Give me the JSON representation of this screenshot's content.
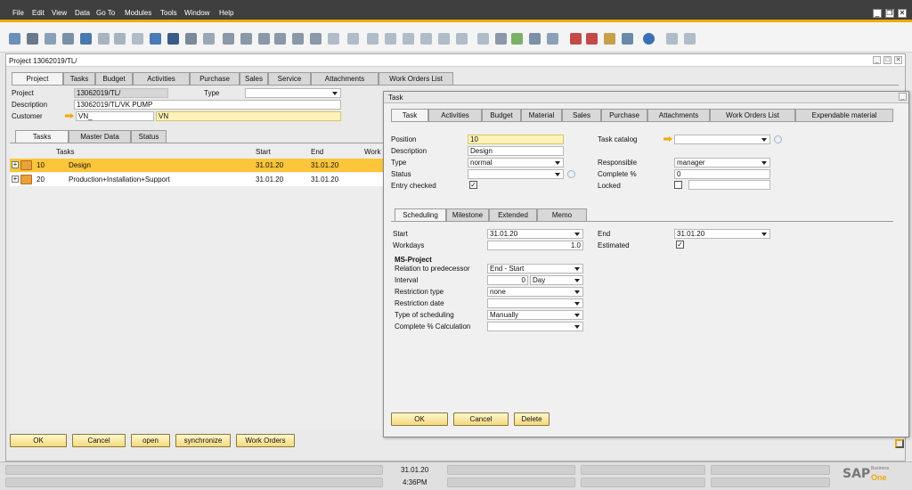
{
  "menu": [
    "File",
    "Edit",
    "View",
    "Data",
    "Go To",
    "Modules",
    "Tools",
    "Window",
    "Help"
  ],
  "project_window": {
    "title": "Project 13062019/TL/",
    "tabs": [
      "Project",
      "Tasks",
      "Budget",
      "Activities",
      "Purchase",
      "Sales",
      "Service",
      "Attachments",
      "Work Orders List"
    ],
    "fields": {
      "project_label": "Project",
      "project_value": "13062019/TL/",
      "type_label": "Type",
      "type_value": "",
      "description_label": "Description",
      "description_value": "13062019/TL/VK PUMP",
      "customer_label": "Customer",
      "customer_code": "VN_",
      "customer_name": "VN"
    },
    "sub_tabs": [
      "Tasks",
      "Master Data",
      "Status"
    ],
    "grid_headers": [
      "Tasks",
      "Start",
      "End",
      "Work"
    ],
    "rows": [
      {
        "num": "10",
        "name": "Design",
        "start": "31.01.20",
        "end": "31.01.20"
      },
      {
        "num": "20",
        "name": "Production+Installation+Support",
        "start": "31.01.20",
        "end": "31.01.20"
      }
    ],
    "buttons": {
      "ok": "OK",
      "cancel": "Cancel",
      "open": "open",
      "synchronize": "synchronize",
      "work_orders": "Work Orders"
    }
  },
  "task_window": {
    "title": "Task",
    "tabs": [
      "Task",
      "Activities",
      "Budget",
      "Material",
      "Sales",
      "Purchase",
      "Attachments",
      "Work Orders List",
      "Expendable material"
    ],
    "fields": {
      "position_label": "Position",
      "position_value": "10",
      "description_label": "Description",
      "description_value": "Design",
      "type_label": "Type",
      "type_value": "normal",
      "status_label": "Status",
      "status_value": "",
      "entry_checked_label": "Entry checked",
      "task_catalog_label": "Task catalog",
      "task_catalog_value": "",
      "responsible_label": "Responsible",
      "responsible_value": "manager",
      "complete_label": "Complete %",
      "complete_value": "0",
      "locked_label": "Locked"
    },
    "sub_tabs": [
      "Scheduling",
      "Milestone",
      "Extended",
      "Memo"
    ],
    "scheduling": {
      "start_label": "Start",
      "start_value": "31.01.20",
      "end_label": "End",
      "end_value": "31.01.20",
      "workdays_label": "Workdays",
      "workdays_value": "1.0",
      "estimated_label": "Estimated",
      "ms_project_heading": "MS-Project",
      "relation_label": "Relation to predecessor",
      "relation_value": "End - Start",
      "interval_label": "Interval",
      "interval_value": "0",
      "interval_unit": "Day",
      "restriction_type_label": "Restriction type",
      "restriction_type_value": "none",
      "restriction_date_label": "Restriction date",
      "restriction_date_value": "",
      "type_sched_label": "Type of scheduling",
      "type_sched_value": "Manually",
      "complete_calc_label": "Complete % Calculation",
      "complete_calc_value": ""
    },
    "buttons": {
      "ok": "OK",
      "cancel": "Cancel",
      "delete": "Delete"
    }
  },
  "status_bar": {
    "date": "31.01.20",
    "time": "4:36PM"
  },
  "brand": {
    "sap": "SAP",
    "business": "Business",
    "one": "One"
  },
  "colors": {
    "accent": "#f0ab00",
    "menubar": "#3f3f3f",
    "highlight_row": "#fcc53a"
  }
}
